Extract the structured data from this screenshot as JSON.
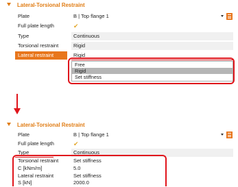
{
  "top": {
    "section_title": "Lateral-Torsional Restraint",
    "rows": [
      {
        "label": "Plate",
        "value": "B | Top flange 1"
      },
      {
        "label": "Full plate length",
        "value": "✔"
      },
      {
        "label": "Type",
        "value": "Continuous"
      },
      {
        "label": "Torsional restraint",
        "value": "Rigid"
      },
      {
        "label": "Lateral restraint",
        "value": "Rigid"
      }
    ],
    "dropdown_options": [
      "Free",
      "Rigid",
      "Set stiffness"
    ],
    "dropdown_highlighted": "Rigid"
  },
  "bottom": {
    "section_title": "Lateral-Torsional Restraint",
    "rows": [
      {
        "label": "Plate",
        "value": "B | Top flange 1"
      },
      {
        "label": "Full plate length",
        "value": "✔"
      },
      {
        "label": "Type",
        "value": "Continuous"
      },
      {
        "label": "Torsional restraint",
        "value": "Set stiffness"
      },
      {
        "label": "C [kNm/m]",
        "value": "5.0"
      },
      {
        "label": "Lateral restraint",
        "value": "Set stiffness"
      },
      {
        "label": "S [kN]",
        "value": "2000.0"
      }
    ]
  },
  "icons": {
    "collapse": "chevron-down-icon",
    "check": "checkmark-icon",
    "dropdown": "dropdown-arrow-icon",
    "menu": "menu-icon",
    "arrow": "arrow-down-icon"
  },
  "colors": {
    "accent": "#e8761c",
    "title": "#e07b12",
    "highlight_box": "#e0141b",
    "check": "#e3a72b"
  }
}
